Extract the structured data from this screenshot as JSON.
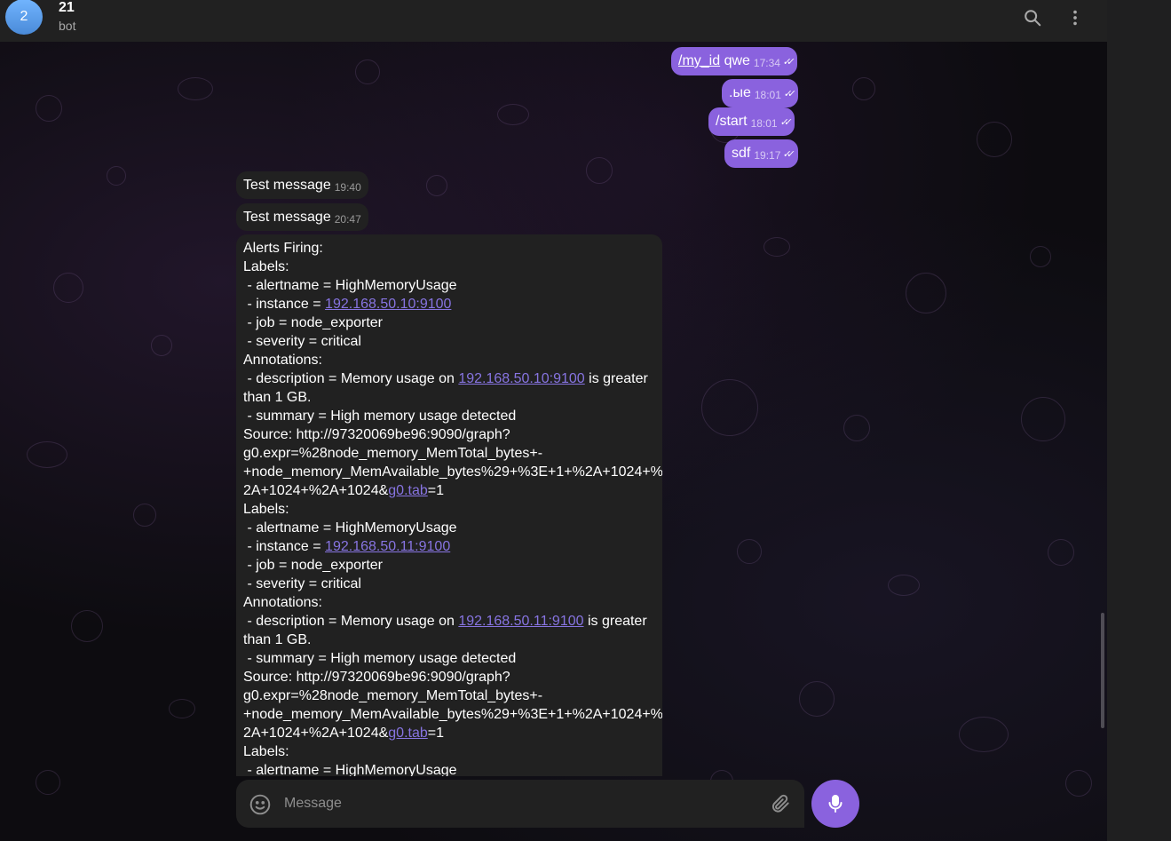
{
  "header": {
    "avatar_letter": "2",
    "title": "21",
    "subtitle": "bot",
    "search_icon": "search-icon",
    "menu_icon": "more-vertical-icon"
  },
  "outgoing": [
    {
      "cmd": "/my_id",
      "text": " qwe",
      "time": "17:34"
    },
    {
      "cmd": "",
      "text": ".ые",
      "time": "18:01"
    },
    {
      "cmd": "",
      "text": "/start",
      "time": "18:01"
    },
    {
      "cmd": "",
      "text": "sdf",
      "time": "19:17"
    }
  ],
  "incoming": [
    {
      "text": "Test message",
      "time": "19:40"
    },
    {
      "text": "Test message",
      "time": "20:47"
    }
  ],
  "alert": {
    "l01": "Alerts Firing:",
    "l02": "Labels:",
    "l03": " - alertname = HighMemoryUsage",
    "l04a": " - instance = ",
    "l04link": "192.168.50.10:9100",
    "l05": " - job = node_exporter",
    "l06": " - severity = critical",
    "l07": "Annotations:",
    "l08a": " - description = Memory usage on ",
    "l08link": "192.168.50.10:9100",
    "l08b": " is greater",
    "l09": "than 1 GB.",
    "l10": " - summary = High memory usage detected",
    "l11": "Source: http://97320069be96:9090/graph?",
    "l12": "g0.expr=%28node_memory_MemTotal_bytes+-",
    "l13": "+node_memory_MemAvailable_bytes%29+%3E+1+%2A+1024+%",
    "l14a": "2A+1024+%2A+1024&",
    "l14link": "g0.tab",
    "l14b": "=1",
    "l15": "Labels:",
    "l16": " - alertname = HighMemoryUsage",
    "l17a": " - instance = ",
    "l17link": "192.168.50.11:9100",
    "l18": " - job = node_exporter",
    "l19": " - severity = critical",
    "l20": "Annotations:",
    "l21a": " - description = Memory usage on ",
    "l21link": "192.168.50.11:9100",
    "l21b": " is greater",
    "l22": "than 1 GB.",
    "l23": " - summary = High memory usage detected",
    "l24": "Source: http://97320069be96:9090/graph?",
    "l25": "g0.expr=%28node_memory_MemTotal_bytes+-",
    "l26": "+node_memory_MemAvailable_bytes%29+%3E+1+%2A+1024+%",
    "l27a": "2A+1024+%2A+1024&",
    "l27link": "g0.tab",
    "l27b": "=1",
    "l28": "Labels:",
    "l29": " - alertname = HighMemoryUsage"
  },
  "composer": {
    "placeholder": "Message",
    "emoji_icon": "smile-icon",
    "attach_icon": "paperclip-icon",
    "mic_icon": "microphone-icon"
  },
  "colors": {
    "accent": "#8a62de",
    "link": "#8774e1",
    "bubble_in": "#212121",
    "header_bg": "#212121"
  }
}
